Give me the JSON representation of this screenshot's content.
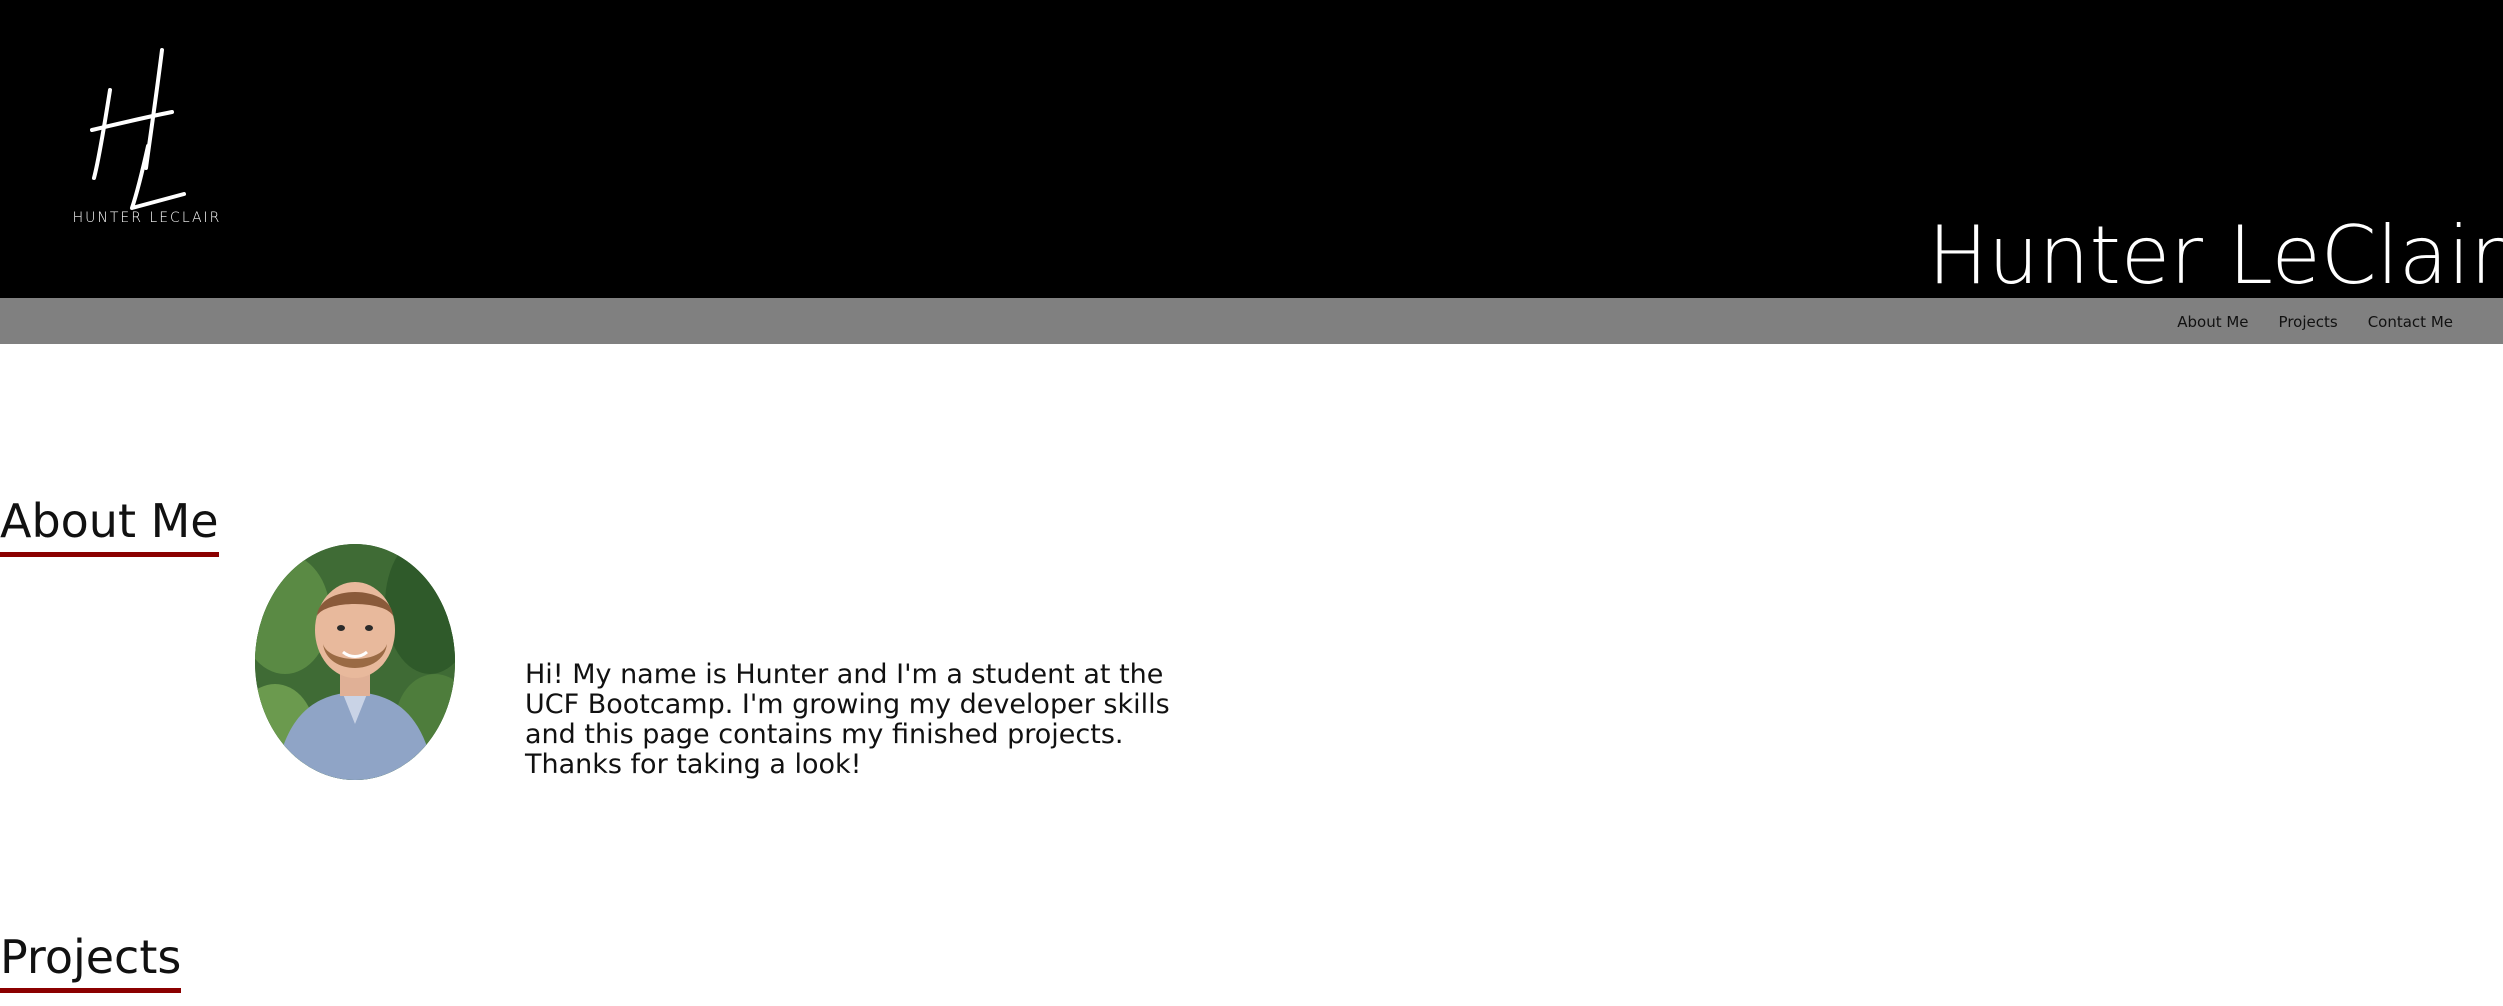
{
  "header": {
    "logo_monogram": "HL",
    "logo_wordmark": "HUNTER LECLAIR",
    "site_title": "Hunter LeClair"
  },
  "nav": {
    "items": [
      {
        "label": "About Me"
      },
      {
        "label": "Projects"
      },
      {
        "label": "Contact Me"
      }
    ]
  },
  "about": {
    "heading": "About Me",
    "avatar_icon": "profile-photo",
    "text": "Hi! My name is Hunter and I'm a student at the UCF Bootcamp. I'm growing my developer skills and this page contains my finished projects. Thanks for taking a look!"
  },
  "projects": {
    "heading": "Projects"
  },
  "colors": {
    "header_bg": "#000000",
    "nav_bg": "#808080",
    "heading_underline": "#8b0000",
    "page_bg": "#ffffff"
  }
}
